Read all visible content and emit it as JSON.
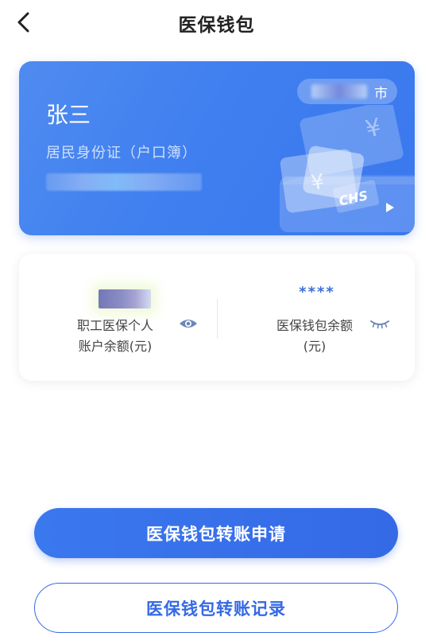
{
  "header": {
    "title": "医保钱包",
    "back_icon": "chevron-left-icon"
  },
  "card": {
    "holder_name": "张三",
    "id_type": "居民身份证（户口簿）",
    "city_suffix": "市",
    "logo_text": "CHS",
    "colors": {
      "primary": "#3f7fef",
      "accent": "#3569e6"
    }
  },
  "balances": {
    "employee_label": "职工医保个人\n账户余额(元)",
    "wallet_mask": "****",
    "wallet_label": "医保钱包余额\n(元)"
  },
  "actions": {
    "transfer_apply": "医保钱包转账申请",
    "transfer_records": "医保钱包转账记录"
  }
}
